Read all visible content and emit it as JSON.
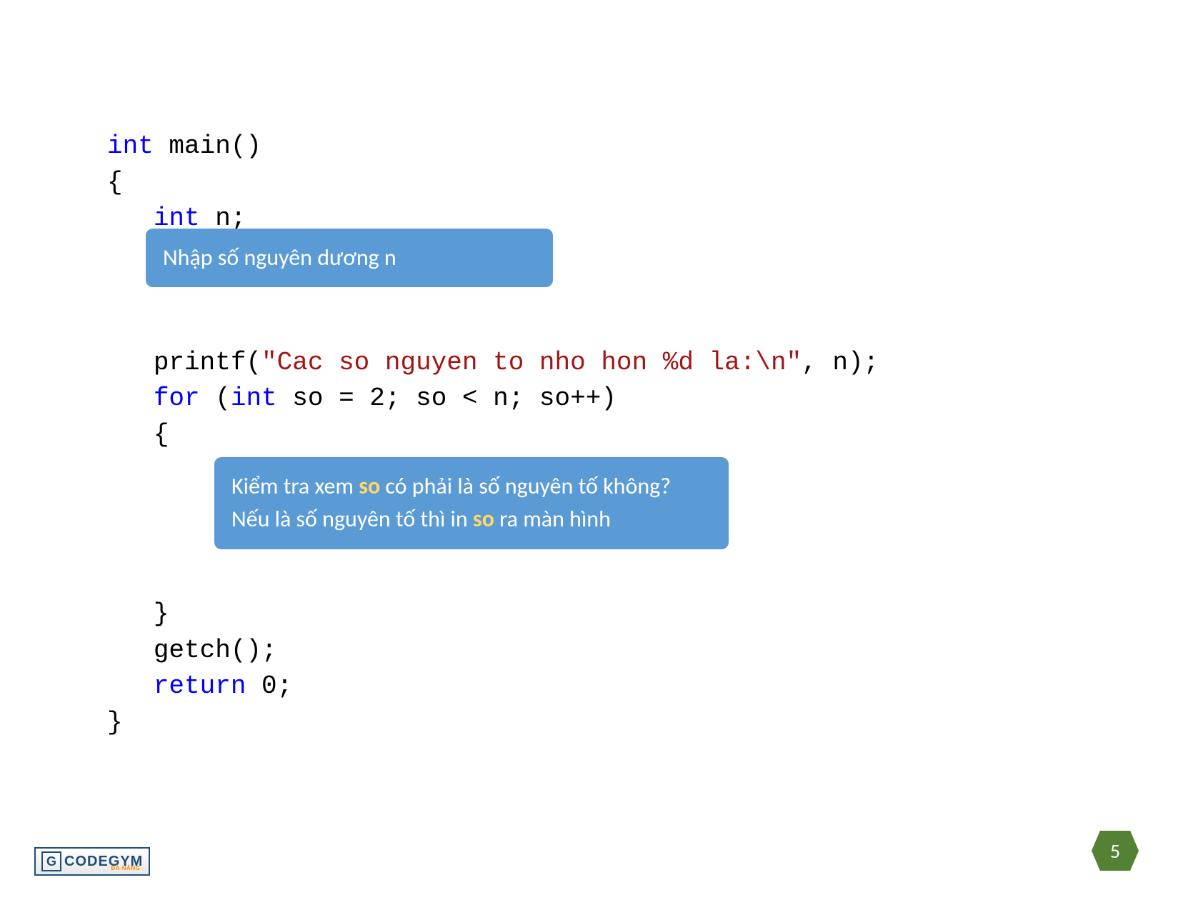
{
  "code": {
    "l1_kw": "int",
    "l1_rest": " main()",
    "l2": "{",
    "l3_ind": "   ",
    "l3_kw": "int",
    "l3_rest": " n;",
    "l4_ind": "   ",
    "l4_pre": "printf(",
    "l4_str": "\"Cac so nguyen to nho hon %d la:\\n\"",
    "l4_post": ", n);",
    "l5_ind": "   ",
    "l5_kw1": "for",
    "l5_mid1": " (",
    "l5_kw2": "int",
    "l5_mid2": " so = 2; so < n; so++)",
    "l6_ind": "   ",
    "l6": "{",
    "l7_ind": "   ",
    "l7": "}",
    "l8_ind": "   ",
    "l8": "getch();",
    "l9_ind": "   ",
    "l9_kw": "return",
    "l9_rest": " 0;",
    "l10": "}"
  },
  "box1": {
    "text": "Nhập số nguyên dương n"
  },
  "box2": {
    "line1_pre": "Kiểm tra xem ",
    "line1_hl": "so",
    "line1_post": " có phải là số nguyên tố không?",
    "line2_pre": "Nếu là số nguyên tố thì in ",
    "line2_hl": "so",
    "line2_post": " ra màn hình"
  },
  "page_number": "5",
  "logo": {
    "icon": "G",
    "text": "CODEGYM",
    "sub": "ĐÀ NẴNG"
  }
}
